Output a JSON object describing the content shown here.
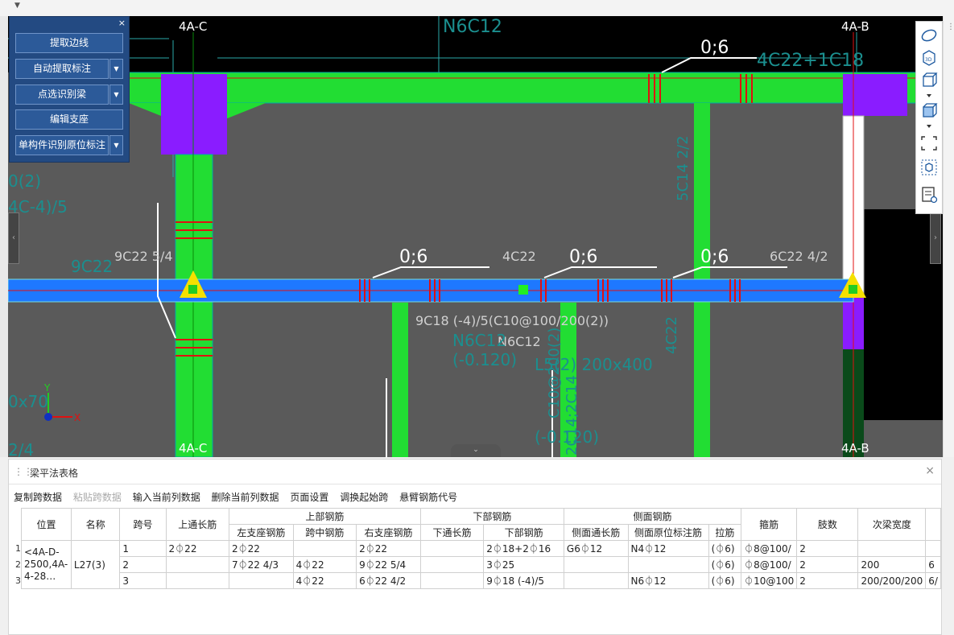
{
  "canvas": {
    "axes": {
      "top_left": "4A-C",
      "top_right": "4A-B",
      "bottom_left": "4A-C",
      "bottom_right": "4A-B"
    },
    "labels": [
      "N6C12",
      "4C22+1C18",
      "0;6",
      "0;6",
      "0;6",
      "0;6",
      "4C22",
      "9C22 5/4",
      "6C22 4/2",
      "9C18 (-4)/5(C10@100/200(2))",
      "N6C12",
      "0(2)",
      "4C-4)/5",
      "9C22",
      "0x70",
      "2/4",
      "(-0.120)",
      "L5(2) 200x400",
      "N6C12",
      "(-0.120)",
      "5C14 2/2",
      "4C22",
      "C10@200(2)",
      "2C14;2C14"
    ],
    "coord_axis": {
      "y": "Y",
      "x": "X"
    }
  },
  "cmd_panel": {
    "close": "×",
    "buttons": [
      "提取边线",
      "自动提取标注",
      "点选识别梁",
      "编辑支座",
      "单构件识别原位标注"
    ],
    "arrow": "▼"
  },
  "view_toolbar": {
    "icons": [
      "orbit-icon",
      "3d-view-icon",
      "cube-view-icon",
      "cube-face-icon",
      "zoom-extents-icon",
      "select-icon",
      "properties-icon"
    ]
  },
  "panel": {
    "title": "梁平法表格",
    "close": "×",
    "grip": "⋮⋮",
    "toolbar": [
      "复制跨数据",
      "粘贴跨数据",
      "输入当前列数据",
      "删除当前列数据",
      "页面设置",
      "调换起始跨",
      "悬臂钢筋代号"
    ],
    "headers": {
      "position": "位置",
      "name": "名称",
      "span": "跨号",
      "top_through": "上通长筋",
      "top_group": "上部钢筋",
      "left_support": "左支座钢筋",
      "mid_span": "跨中钢筋",
      "right_support": "右支座钢筋",
      "bottom_group": "下部钢筋",
      "bottom_through": "下通长筋",
      "bottom": "下部钢筋",
      "side_group": "侧面钢筋",
      "side_through": "侧面通长筋",
      "side_original": "侧面原位标注筋",
      "tie": "拉筋",
      "stirrup": "箍筋",
      "legs": "肢数",
      "secondary_width": "次梁宽度"
    },
    "position_value": "<4A-D-2500,4A-4-28…",
    "name_value": "L27(3)",
    "rows": [
      {
        "num": "1",
        "span": "1",
        "top_through": "2⏀22",
        "left_support": "2⏀22",
        "mid_span": "",
        "right_support": "2⏀22",
        "bottom_through": "",
        "bottom": "2⏀18+2⏀16",
        "side_through": "G6⏀12",
        "side_original": "N4⏀12",
        "tie": "(⏀6)",
        "stirrup": "⏀8@100/",
        "legs": "2",
        "secondary_width": "",
        "extra": ""
      },
      {
        "num": "2",
        "span": "2",
        "top_through": "",
        "left_support": "7⏀22 4/3",
        "mid_span": "4⏀22",
        "right_support": "9⏀22 5/4",
        "bottom_through": "",
        "bottom": "3⏀25",
        "side_through": "",
        "side_original": "",
        "tie": "(⏀6)",
        "stirrup": "⏀8@100/",
        "legs": "2",
        "secondary_width": "200",
        "extra": "6"
      },
      {
        "num": "3",
        "span": "3",
        "top_through": "",
        "left_support": "",
        "mid_span": "4⏀22",
        "right_support": "6⏀22 4/2",
        "bottom_through": "",
        "bottom": "9⏀18 (-4)/5",
        "side_through": "",
        "side_original": "N6⏀12",
        "tie": "(⏀6)",
        "stirrup": "⏀10@100",
        "legs": "2",
        "secondary_width": "200/200/200",
        "extra": "6/"
      }
    ]
  }
}
